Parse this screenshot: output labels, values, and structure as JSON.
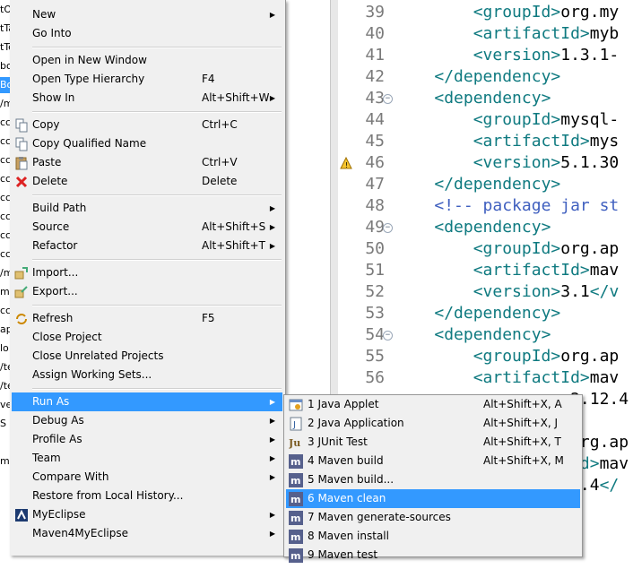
{
  "explorer": {
    "rows": [
      "tO",
      "tTa",
      "tTe",
      "bo",
      "Bo",
      "/m",
      "cc",
      "cc",
      "cc",
      "cc",
      "cc",
      "cc",
      "cc",
      "cc",
      "/m",
      "m",
      "cc",
      "ap",
      "lo",
      "/te",
      "/te",
      "ve",
      "S",
      "",
      "m",
      "",
      "",
      "",
      ""
    ]
  },
  "editor": {
    "lines": [
      {
        "n": "39",
        "parts": [
          [
            "txt",
            "        "
          ],
          [
            "tag",
            "<groupId>"
          ],
          [
            "txt",
            "org.my"
          ]
        ]
      },
      {
        "n": "40",
        "parts": [
          [
            "txt",
            "        "
          ],
          [
            "tag",
            "<artifactId>"
          ],
          [
            "txt",
            "myb"
          ]
        ]
      },
      {
        "n": "41",
        "parts": [
          [
            "txt",
            "        "
          ],
          [
            "tag",
            "<version>"
          ],
          [
            "txt",
            "1.3.1-"
          ]
        ]
      },
      {
        "n": "42",
        "parts": [
          [
            "txt",
            "    "
          ],
          [
            "tag",
            "</dependency>"
          ]
        ]
      },
      {
        "n": "43",
        "fold": true,
        "parts": [
          [
            "txt",
            "    "
          ],
          [
            "tag",
            "<dependency>"
          ]
        ]
      },
      {
        "n": "44",
        "parts": [
          [
            "txt",
            "        "
          ],
          [
            "tag",
            "<groupId>"
          ],
          [
            "txt",
            "mysql-"
          ]
        ]
      },
      {
        "n": "45",
        "parts": [
          [
            "txt",
            "        "
          ],
          [
            "tag",
            "<artifactId>"
          ],
          [
            "txt",
            "mys"
          ]
        ]
      },
      {
        "n": "46",
        "warn": true,
        "parts": [
          [
            "txt",
            "        "
          ],
          [
            "tag",
            "<version>"
          ],
          [
            "txt",
            "5.1.30"
          ]
        ]
      },
      {
        "n": "47",
        "parts": [
          [
            "txt",
            "    "
          ],
          [
            "tag",
            "</dependency>"
          ]
        ]
      },
      {
        "n": "48",
        "parts": [
          [
            "txt",
            "    "
          ],
          [
            "cmt",
            "<!-- package jar st"
          ]
        ]
      },
      {
        "n": "49",
        "fold": true,
        "parts": [
          [
            "txt",
            "    "
          ],
          [
            "tag",
            "<dependency>"
          ]
        ]
      },
      {
        "n": "50",
        "parts": [
          [
            "txt",
            "        "
          ],
          [
            "tag",
            "<groupId>"
          ],
          [
            "txt",
            "org.ap"
          ]
        ]
      },
      {
        "n": "51",
        "parts": [
          [
            "txt",
            "        "
          ],
          [
            "tag",
            "<artifactId>"
          ],
          [
            "txt",
            "mav"
          ]
        ]
      },
      {
        "n": "52",
        "parts": [
          [
            "txt",
            "        "
          ],
          [
            "tag",
            "<version>"
          ],
          [
            "txt",
            "3.1"
          ],
          [
            "tag",
            "</v"
          ]
        ]
      },
      {
        "n": "53",
        "parts": [
          [
            "txt",
            "    "
          ],
          [
            "tag",
            "</dependency>"
          ]
        ]
      },
      {
        "n": "54",
        "fold": true,
        "parts": [
          [
            "txt",
            "    "
          ],
          [
            "tag",
            "<dependency>"
          ]
        ]
      },
      {
        "n": "55",
        "parts": [
          [
            "txt",
            "        "
          ],
          [
            "tag",
            "<groupId>"
          ],
          [
            "txt",
            "org.ap"
          ]
        ]
      },
      {
        "n": "56",
        "parts": [
          [
            "txt",
            "        "
          ],
          [
            "tag",
            "<artifactId>"
          ],
          [
            "txt",
            "mav"
          ]
        ]
      },
      {
        "n": "",
        "parts": [
          [
            "txt",
            "                  2.12.4"
          ]
        ]
      },
      {
        "n": "",
        "parts": []
      },
      {
        "n": "",
        "parts": [
          [
            "txt",
            "                  org.ap"
          ]
        ]
      },
      {
        "n": "",
        "parts": [
          [
            "tag",
            "                  Id>"
          ],
          [
            "txt",
            "mav"
          ]
        ]
      },
      {
        "n": "",
        "parts": [
          [
            "txt",
            "                  2.4"
          ],
          [
            "tag",
            "</"
          ]
        ]
      }
    ]
  },
  "menu": {
    "items": [
      {
        "type": "item",
        "label": "New",
        "arrow": true
      },
      {
        "type": "item",
        "label": "Go Into"
      },
      {
        "type": "sep"
      },
      {
        "type": "item",
        "label": "Open in New Window"
      },
      {
        "type": "item",
        "label": "Open Type Hierarchy",
        "acc": "F4"
      },
      {
        "type": "item",
        "label": "Show In",
        "acc": "Alt+Shift+W",
        "arrow": true
      },
      {
        "type": "sep"
      },
      {
        "type": "item",
        "label": "Copy",
        "acc": "Ctrl+C",
        "icon": "copy-icon"
      },
      {
        "type": "item",
        "label": "Copy Qualified Name",
        "icon": "copy-icon"
      },
      {
        "type": "item",
        "label": "Paste",
        "acc": "Ctrl+V",
        "icon": "paste-icon"
      },
      {
        "type": "item",
        "label": "Delete",
        "acc": "Delete",
        "icon": "delete-icon"
      },
      {
        "type": "sep"
      },
      {
        "type": "item",
        "label": "Build Path",
        "arrow": true
      },
      {
        "type": "item",
        "label": "Source",
        "acc": "Alt+Shift+S",
        "arrow": true
      },
      {
        "type": "item",
        "label": "Refactor",
        "acc": "Alt+Shift+T",
        "arrow": true
      },
      {
        "type": "sep"
      },
      {
        "type": "item",
        "label": "Import...",
        "icon": "import-icon"
      },
      {
        "type": "item",
        "label": "Export...",
        "icon": "export-icon"
      },
      {
        "type": "sep"
      },
      {
        "type": "item",
        "label": "Refresh",
        "acc": "F5",
        "icon": "refresh-icon"
      },
      {
        "type": "item",
        "label": "Close Project"
      },
      {
        "type": "item",
        "label": "Close Unrelated Projects"
      },
      {
        "type": "item",
        "label": "Assign Working Sets..."
      },
      {
        "type": "sep"
      },
      {
        "type": "item",
        "label": "Run As",
        "arrow": true,
        "highlight": true
      },
      {
        "type": "item",
        "label": "Debug As",
        "arrow": true
      },
      {
        "type": "item",
        "label": "Profile As",
        "arrow": true
      },
      {
        "type": "item",
        "label": "Team",
        "arrow": true
      },
      {
        "type": "item",
        "label": "Compare With",
        "arrow": true
      },
      {
        "type": "item",
        "label": "Restore from Local History..."
      },
      {
        "type": "item",
        "label": "MyEclipse",
        "arrow": true,
        "icon": "myeclipse-icon"
      },
      {
        "type": "item",
        "label": "Maven4MyEclipse",
        "arrow": true
      }
    ]
  },
  "submenu": {
    "items": [
      {
        "label": "1 Java Applet",
        "acc": "Alt+Shift+X, A",
        "icon": "java-applet-icon"
      },
      {
        "label": "2 Java Application",
        "acc": "Alt+Shift+X, J",
        "icon": "java-application-icon"
      },
      {
        "label": "3 JUnit Test",
        "acc": "Alt+Shift+X, T",
        "icon": "junit-icon"
      },
      {
        "label": "4 Maven build",
        "acc": "Alt+Shift+X, M",
        "icon": "maven-icon"
      },
      {
        "label": "5 Maven build...",
        "icon": "maven-icon"
      },
      {
        "label": "6 Maven clean",
        "icon": "maven-icon",
        "highlight": true
      },
      {
        "label": "7 Maven generate-sources",
        "icon": "maven-icon"
      },
      {
        "label": "8 Maven install",
        "icon": "maven-icon"
      },
      {
        "label": "9 Maven test",
        "icon": "maven-icon"
      }
    ]
  },
  "colors": {
    "highlight": "#3399ff",
    "menu_bg": "#f0f0f0",
    "xml_tag": "#0f7a80",
    "comment": "#3f5fbf"
  }
}
